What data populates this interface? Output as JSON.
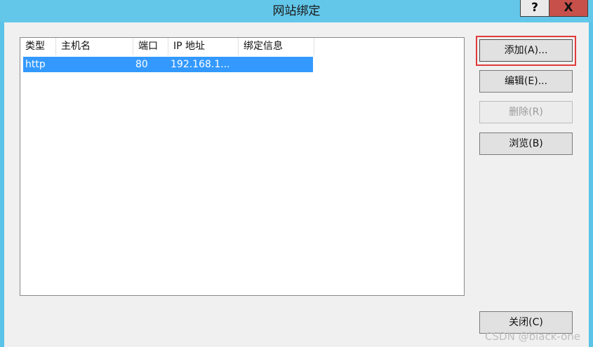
{
  "window": {
    "title": "网站绑定",
    "help_label": "?",
    "close_label": "X"
  },
  "table": {
    "columns": [
      "类型",
      "主机名",
      "端口",
      "IP 地址",
      "绑定信息"
    ],
    "rows": [
      {
        "type": "http",
        "host": "",
        "port": "80",
        "ip": "192.168.1...",
        "binding": ""
      }
    ]
  },
  "buttons": {
    "add": "添加(A)...",
    "edit": "编辑(E)...",
    "delete": "删除(R)",
    "browse": "浏览(B)",
    "close": "关闭(C)"
  },
  "watermark": "CSDN @black-one",
  "colors": {
    "titlebar": "#63c7ea",
    "selection": "#3399ff",
    "highlight": "#e23b3b",
    "close_button": "#c7504b"
  }
}
